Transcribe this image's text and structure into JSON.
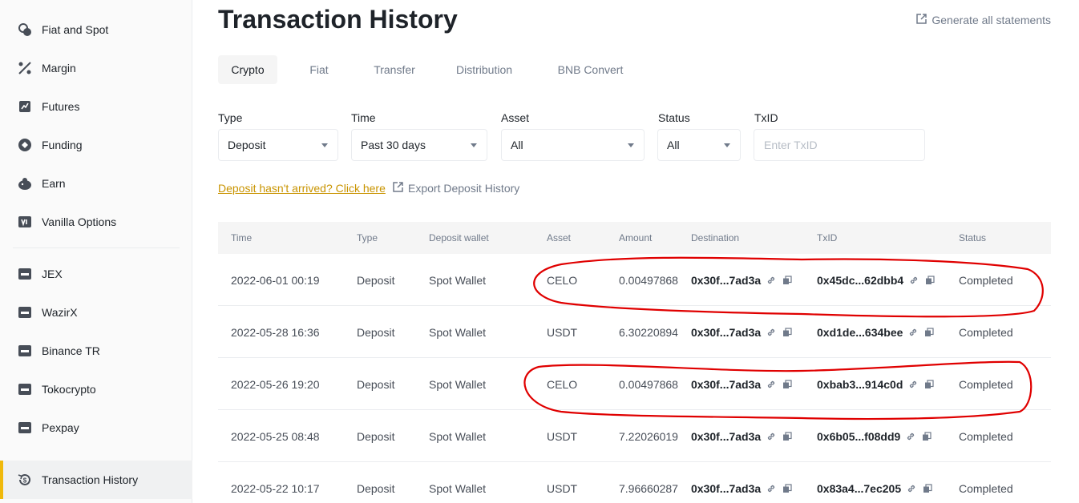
{
  "sidebar": {
    "items": [
      {
        "label": "Fiat and Spot",
        "icon": "fiat-spot-icon"
      },
      {
        "label": "Margin",
        "icon": "margin-icon"
      },
      {
        "label": "Futures",
        "icon": "futures-icon"
      },
      {
        "label": "Funding",
        "icon": "funding-icon"
      },
      {
        "label": "Earn",
        "icon": "earn-icon"
      },
      {
        "label": "Vanilla Options",
        "icon": "vanilla-options-icon"
      },
      {
        "label": "JEX",
        "icon": "wallet-icon"
      },
      {
        "label": "WazirX",
        "icon": "wallet-icon"
      },
      {
        "label": "Binance TR",
        "icon": "wallet-icon"
      },
      {
        "label": "Tokocrypto",
        "icon": "wallet-icon"
      },
      {
        "label": "Pexpay",
        "icon": "wallet-icon"
      },
      {
        "label": "Transaction History",
        "icon": "transaction-history-icon"
      }
    ]
  },
  "header": {
    "title": "Transaction History",
    "generate_label": "Generate all statements"
  },
  "tabs": [
    "Crypto",
    "Fiat",
    "Transfer",
    "Distribution",
    "BNB Convert"
  ],
  "filters": {
    "type": {
      "label": "Type",
      "value": "Deposit"
    },
    "time": {
      "label": "Time",
      "value": "Past 30 days"
    },
    "asset": {
      "label": "Asset",
      "value": "All"
    },
    "status": {
      "label": "Status",
      "value": "All"
    },
    "txid": {
      "label": "TxID",
      "placeholder": "Enter TxID"
    }
  },
  "links": {
    "deposit_help": "Deposit hasn't arrived? Click here",
    "export": "Export Deposit History"
  },
  "table": {
    "headers": [
      "Time",
      "Type",
      "Deposit wallet",
      "Asset",
      "Amount",
      "Destination",
      "TxID",
      "Status"
    ],
    "rows": [
      {
        "time": "2022-06-01 00:19",
        "type": "Deposit",
        "wallet": "Spot Wallet",
        "asset": "CELO",
        "amount": "0.00497868",
        "destination": "0x30f...7ad3a",
        "txid": "0x45dc...62dbb4",
        "status": "Completed"
      },
      {
        "time": "2022-05-28 16:36",
        "type": "Deposit",
        "wallet": "Spot Wallet",
        "asset": "USDT",
        "amount": "6.30220894",
        "destination": "0x30f...7ad3a",
        "txid": "0xd1de...634bee",
        "status": "Completed"
      },
      {
        "time": "2022-05-26 19:20",
        "type": "Deposit",
        "wallet": "Spot Wallet",
        "asset": "CELO",
        "amount": "0.00497868",
        "destination": "0x30f...7ad3a",
        "txid": "0xbab3...914c0d",
        "status": "Completed"
      },
      {
        "time": "2022-05-25 08:48",
        "type": "Deposit",
        "wallet": "Spot Wallet",
        "asset": "USDT",
        "amount": "7.22026019",
        "destination": "0x30f...7ad3a",
        "txid": "0x6b05...f08dd9",
        "status": "Completed"
      },
      {
        "time": "2022-05-22 10:17",
        "type": "Deposit",
        "wallet": "Spot Wallet",
        "asset": "USDT",
        "amount": "7.96660287",
        "destination": "0x30f...7ad3a",
        "txid": "0x83a4...7ec205",
        "status": "Completed"
      }
    ]
  },
  "colors": {
    "accent": "#f0b90b",
    "link": "#c99400",
    "annotation": "#e00000"
  }
}
